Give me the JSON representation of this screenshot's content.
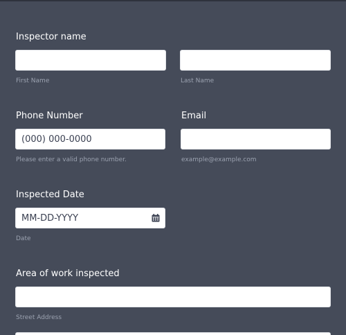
{
  "inspector_name": {
    "label": "Inspector name",
    "first_value": "",
    "first_sublabel": "First Name",
    "last_value": "",
    "last_sublabel": "Last Name"
  },
  "phone": {
    "label": "Phone Number",
    "placeholder": "(000) 000-0000",
    "sublabel": "Please enter a valid phone number."
  },
  "email": {
    "label": "Email",
    "value": "",
    "sublabel": "example@example.com"
  },
  "inspected_date": {
    "label": "Inspected Date",
    "placeholder": "MM-DD-YYYY",
    "sublabel": "Date",
    "icon": "calendar-icon"
  },
  "area": {
    "label": "Area of work inspected",
    "street_value": "",
    "street_sublabel": "Street Address"
  },
  "colors": {
    "background": "#454b59",
    "field": "#ffffff",
    "label": "#ffffff",
    "sublabel": "#9ba2b0"
  }
}
